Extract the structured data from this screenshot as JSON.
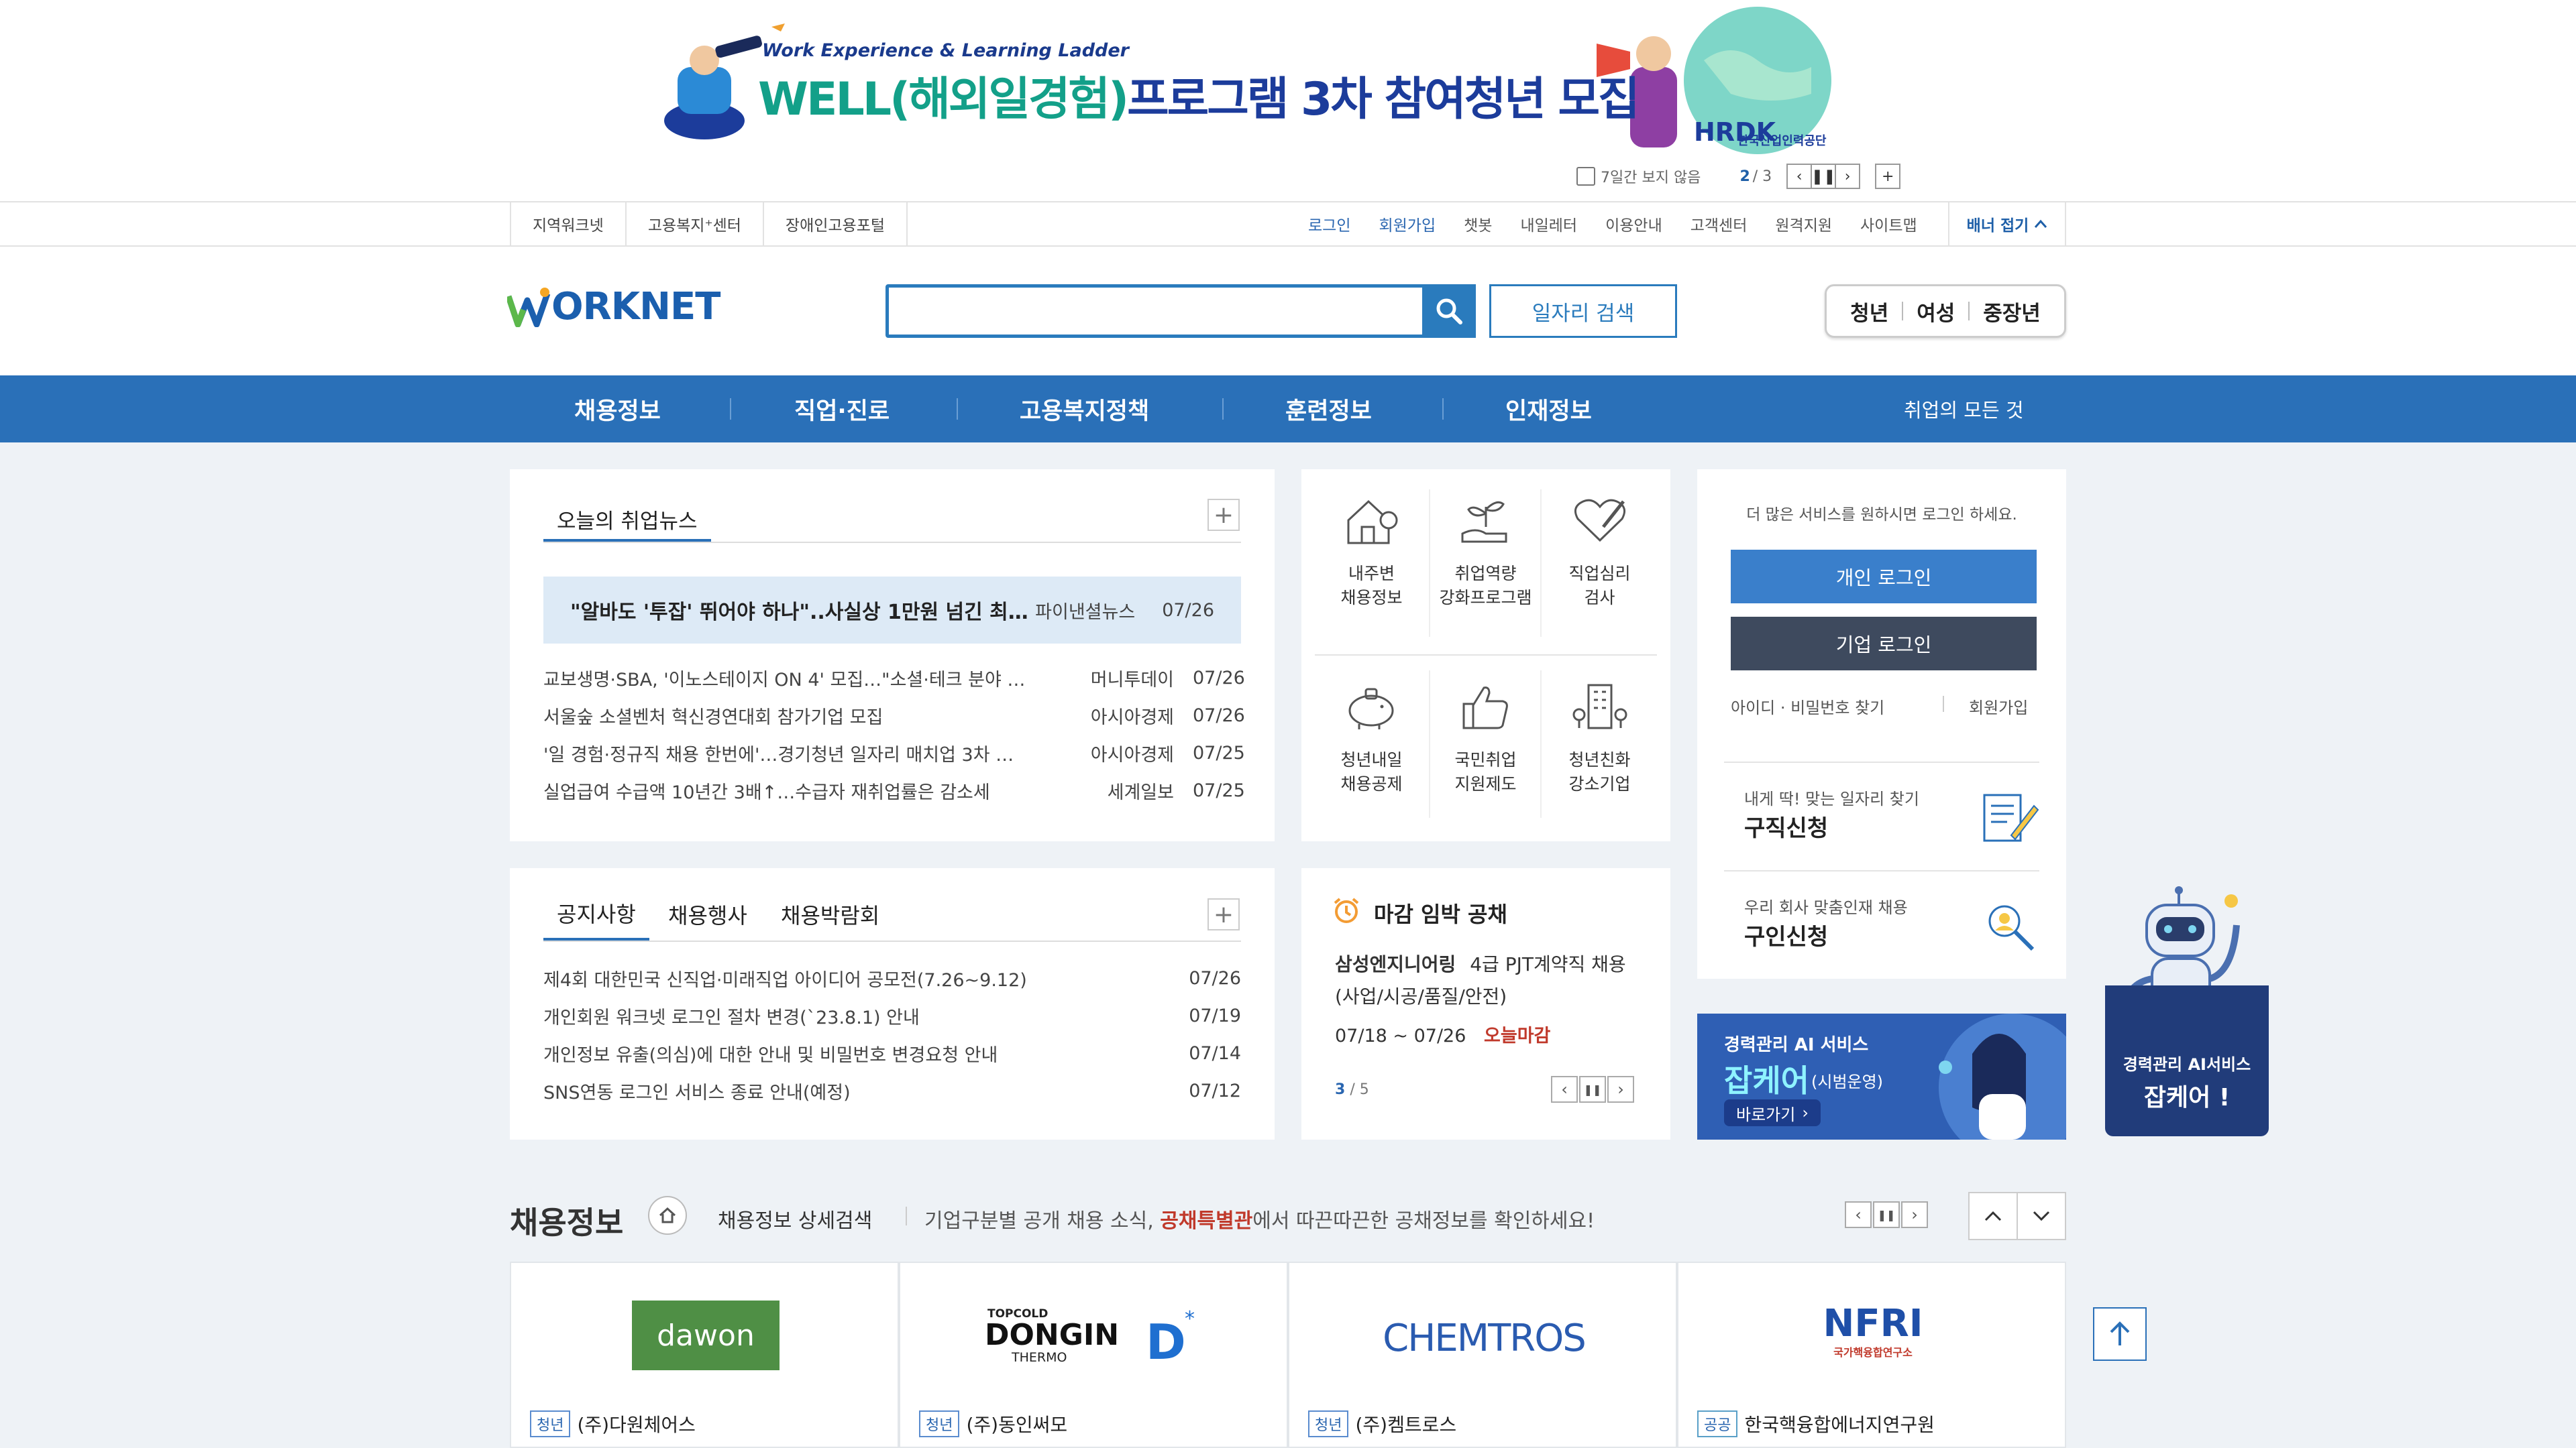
{
  "banner": {
    "subtitle": "Work Experience & Learning Ladder",
    "title_accent": "WELL(해외일경험)",
    "title_main": "프로그램 3차 참여청년 모집",
    "org_logo": "HRDK",
    "org_name": "한국산업인력공단",
    "hide_7days": "7일간 보지 않음",
    "page_current": "2",
    "page_total": "/ 3"
  },
  "util_nav": {
    "left": [
      "지역워크넷",
      "고용복지⁺센터",
      "장애인고용포털"
    ],
    "right": [
      "로그인",
      "회원가입",
      "챗봇",
      "내일레터",
      "이용안내",
      "고객센터",
      "원격지원",
      "사이트맵"
    ],
    "fold_label": "배너 접기"
  },
  "header": {
    "logo_text": "ORKNET",
    "search_value": "",
    "job_search_label": "일자리 검색",
    "targets": [
      "청년",
      "여성",
      "중장년"
    ]
  },
  "gnb": {
    "items": [
      "채용정보",
      "직업·진로",
      "고용복지정책",
      "훈련정보",
      "인재정보"
    ],
    "all_label": "취업의 모든 것"
  },
  "news": {
    "tab_label": "오늘의 취업뉴스",
    "headline": {
      "title": "\"알바도 '투잡' 뛰어야 하나\"..사실상 1만원 넘긴 최…",
      "source": "파이낸셜뉴스",
      "date": "07/26"
    },
    "items": [
      {
        "title": "교보생명·SBA, '이노스테이지 ON 4' 모집…\"소셜·테크 분야 …",
        "source": "머니투데이",
        "date": "07/26"
      },
      {
        "title": "서울숲 소셜벤처 혁신경연대회 참가기업 모집",
        "source": "아시아경제",
        "date": "07/26"
      },
      {
        "title": "'일 경험·정규직 채용 한번에'…경기청년 일자리 매치업 3차 …",
        "source": "아시아경제",
        "date": "07/25"
      },
      {
        "title": "실업급여 수급액 10년간 3배↑…수급자 재취업률은 감소세",
        "source": "세계일보",
        "date": "07/25"
      }
    ]
  },
  "services": [
    {
      "icon": "house-location-icon",
      "line1": "내주변",
      "line2": "채용정보"
    },
    {
      "icon": "sprout-hand-icon",
      "line1": "취업역량",
      "line2": "강화프로그램"
    },
    {
      "icon": "heart-pencil-icon",
      "line1": "직업심리",
      "line2": "검사"
    },
    {
      "icon": "piggy-bank-icon",
      "line1": "청년내일",
      "line2": "채용공제"
    },
    {
      "icon": "thumbs-up-icon",
      "line1": "국민취업",
      "line2": "지원제도"
    },
    {
      "icon": "building-trees-icon",
      "line1": "청년친화",
      "line2": "강소기업"
    }
  ],
  "login_panel": {
    "prompt": "더 많은 서비스를 원하시면 로그인 하세요.",
    "personal_login": "개인 로그인",
    "corporate_login": "기업 로그인",
    "find_id_pw": "아이디 · 비밀번호 찾기",
    "signup": "회원가입",
    "job_seek_sub": "내게 딱! 맞는 일자리 찾기",
    "job_seek_title": "구직신청",
    "recruit_sub": "우리 회사 맞춤인재 채용",
    "recruit_title": "구인신청"
  },
  "notice": {
    "tabs": [
      "공지사항",
      "채용행사",
      "채용박람회"
    ],
    "items": [
      {
        "title": "제4회 대한민국 신직업·미래직업 아이디어 공모전(7.26~9.12)",
        "date": "07/26"
      },
      {
        "title": "개인회원 워크넷 로그인 절차 변경(`23.8.1) 안내",
        "date": "07/19"
      },
      {
        "title": "개인정보 유출(의심)에 대한 안내 및 비밀번호 변경요청 안내",
        "date": "07/14"
      },
      {
        "title": "SNS연동 로그인 서비스 종료 안내(예정)",
        "date": "07/12"
      }
    ]
  },
  "deadline": {
    "title": "마감 임박 공채",
    "company": "삼성엔지니어링",
    "position_line1": "4급 PJT계약직 채용",
    "position_line2": "(사업/시공/품질/안전)",
    "period": "07/18 ~ 07/26",
    "status": "오늘마감",
    "page_current": "3",
    "page_total": "/ 5"
  },
  "ai_banner": {
    "title": "경력관리 AI 서비스",
    "brand": "잡케어",
    "note": "(시범운영)",
    "go": "바로가기"
  },
  "robot_banner": {
    "line1": "경력관리 AI서비스",
    "line2": "잡케어 !"
  },
  "job_section": {
    "title": "채용정보",
    "detail_search": "채용정보 상세검색",
    "desc_prefix": "기업구분별 공개 채용 소식,",
    "desc_highlight": "공채특별관",
    "desc_suffix": "에서 따끈따끈한 공채정보를 확인하세요!",
    "cards": [
      {
        "logo": "dawon",
        "tag": "청년",
        "company": "(주)다원체어스"
      },
      {
        "logo_top": "TOPCOLD",
        "logo": "DONGIN",
        "logo_sub": "THERMO",
        "tag": "청년",
        "company": "(주)동인써모"
      },
      {
        "logo": "CHEMTROS",
        "tag": "청년",
        "company": "(주)켐트로스"
      },
      {
        "logo": "NFRI",
        "logo_sub": "국가핵융합연구소",
        "tag": "공공",
        "company": "한국핵융합에너지연구원"
      }
    ]
  },
  "colors": {
    "primary": "#2a70b8",
    "navy": "#3e4a5e",
    "highlight_red": "#c0392b",
    "dawon_green": "#4f8f45",
    "nfri_blue": "#1f4fa8"
  }
}
